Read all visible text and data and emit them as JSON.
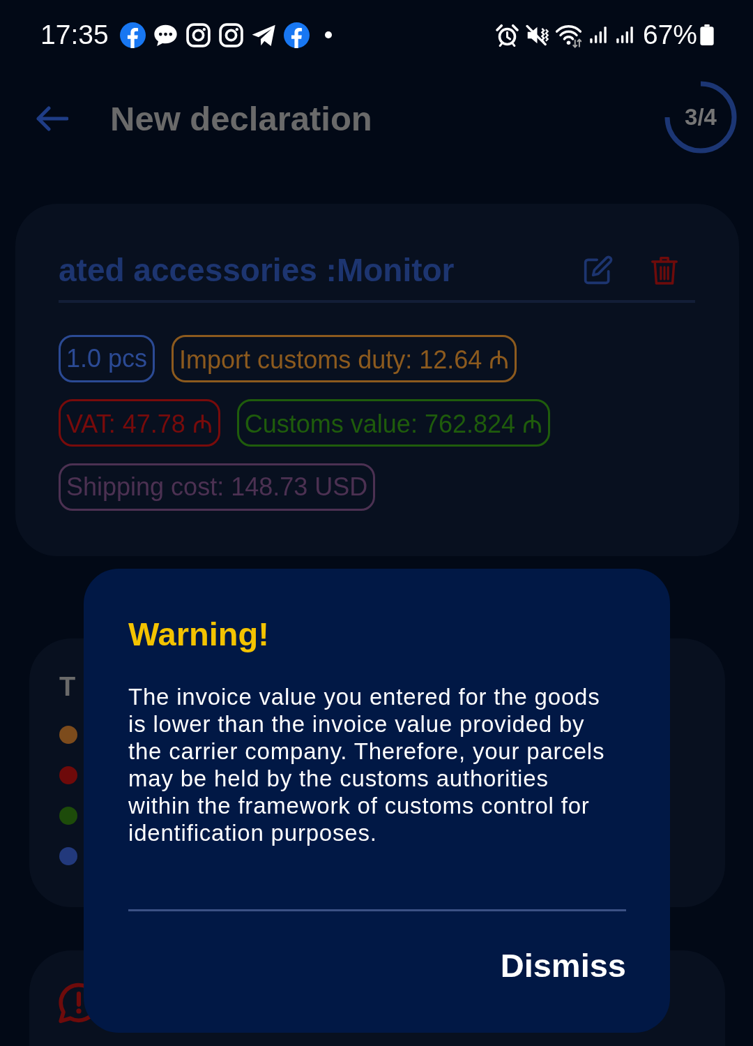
{
  "status_bar": {
    "time": "17:35",
    "battery": "67%"
  },
  "header": {
    "title": "New declaration",
    "step": {
      "text": "3/4",
      "level": 0.75
    }
  },
  "item_card": {
    "title": "ated accessories :Monitor",
    "chips": [
      {
        "text": "1.0 pcs",
        "color": "#2b4a94"
      },
      {
        "text": "Import customs duty: 12.64 ₼",
        "color": "#8c5a1e"
      },
      {
        "text": "VAT: 47.78 ₼",
        "color": "#780b0b"
      },
      {
        "text": "Customs value: 762.824 ₼",
        "color": "#1f5c0c"
      },
      {
        "text": "Shipping cost: 148.73 USD",
        "color": "#4c3152"
      }
    ]
  },
  "summary_card": {
    "title": "T",
    "legend": [
      {
        "color": "#7c4b1c"
      },
      {
        "color": "#6e0a0a"
      },
      {
        "color": "#1d4b0a"
      },
      {
        "color": "#22397c"
      }
    ]
  },
  "dialog": {
    "title": "Warning!",
    "message": "The invoice value you entered for the goods is lower than the invoice value provided by the carrier company. Therefore, your parcels may be held by the customs authorities within the framework of customs control for identification purposes.",
    "button": "Dismiss"
  }
}
